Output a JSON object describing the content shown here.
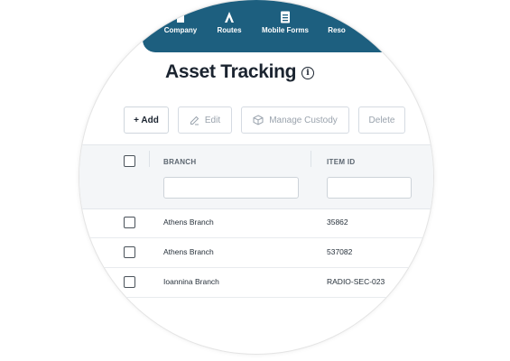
{
  "nav": {
    "items": [
      {
        "label": "Company",
        "icon": "company-icon"
      },
      {
        "label": "Routes",
        "icon": "routes-icon"
      },
      {
        "label": "Mobile Forms",
        "icon": "mobile-forms-icon"
      },
      {
        "label": "Reso",
        "icon": "resources-icon"
      }
    ],
    "background": "#1d5f7f"
  },
  "page": {
    "title": "Asset Tracking",
    "info_glyph": "i"
  },
  "toolbar": {
    "add_label": "+ Add",
    "edit_label": "Edit",
    "manage_custody_label": "Manage Custody",
    "delete_label": "Delete"
  },
  "table": {
    "columns": [
      "BRANCH",
      "ITEM ID"
    ],
    "filters": {
      "branch_value": "",
      "item_id_value": ""
    },
    "rows": [
      {
        "branch": "Athens Branch",
        "item_id": "35862"
      },
      {
        "branch": "Athens Branch",
        "item_id": "537082"
      },
      {
        "branch": "Ioannina Branch",
        "item_id": "RADIO-SEC-023"
      }
    ]
  }
}
